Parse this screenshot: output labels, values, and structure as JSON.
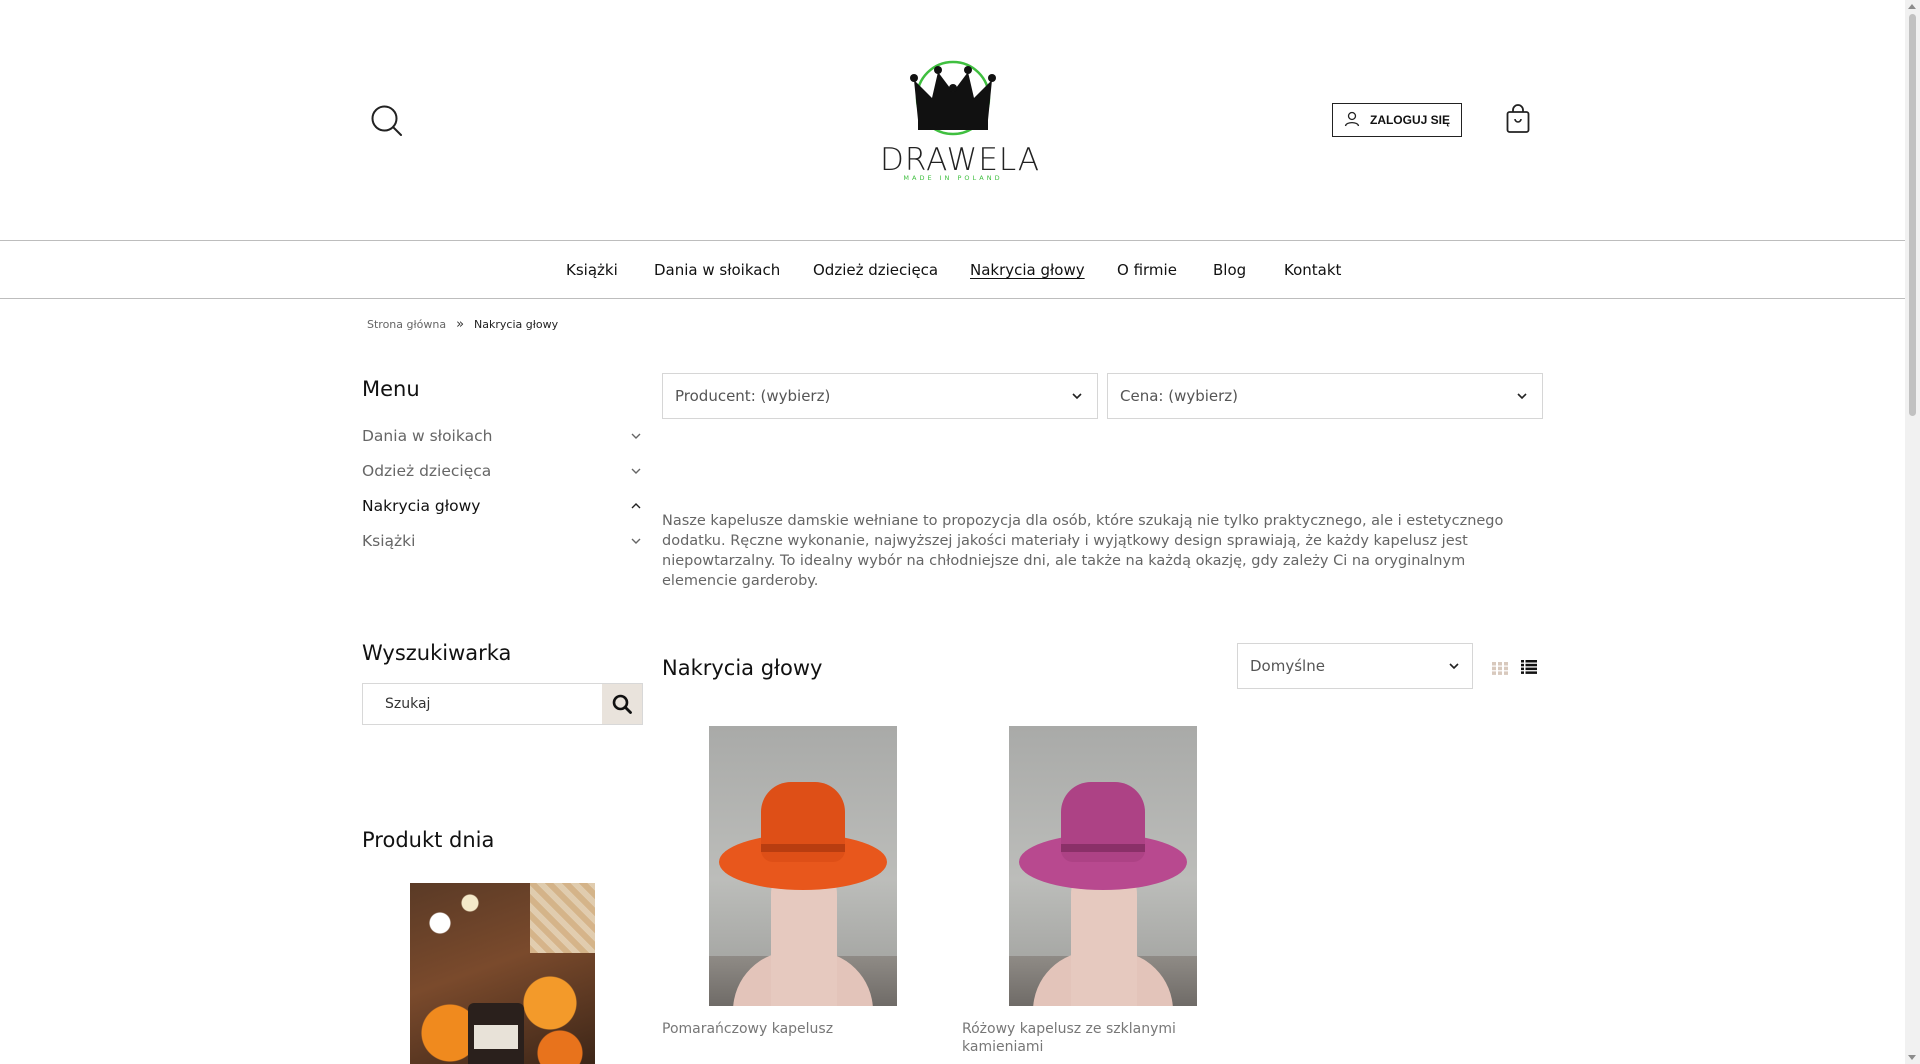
{
  "header": {
    "logo_text": "DRAWELA",
    "logo_sub": "MADE IN POLAND",
    "login_label": "ZALOGUJ SIĘ",
    "brand_color": "#3fbf3f"
  },
  "nav": {
    "items": [
      {
        "label": "Książki"
      },
      {
        "label": "Dania w słoikach"
      },
      {
        "label": "Odzież dziecięca"
      },
      {
        "label": "Nakrycia głowy",
        "active": true
      },
      {
        "label": "O firmie"
      },
      {
        "label": "Blog"
      },
      {
        "label": "Kontakt"
      }
    ]
  },
  "breadcrumb": {
    "home": "Strona główna",
    "separator": "»",
    "current": "Nakrycia głowy"
  },
  "sidebar": {
    "menu_title": "Menu",
    "items": [
      {
        "label": "Dania w słoikach",
        "expanded": false
      },
      {
        "label": "Odzież dziecięca",
        "expanded": false
      },
      {
        "label": "Nakrycia głowy",
        "expanded": true
      },
      {
        "label": "Książki",
        "expanded": false
      }
    ],
    "search_title": "Wyszukiwarka",
    "search_placeholder": "Szukaj",
    "product_day_title": "Produkt dnia"
  },
  "filters": {
    "producer": "Producent: (wybierz)",
    "price": "Cena: (wybierz)"
  },
  "description": "Nasze kapelusze damskie wełniane to propozycja dla osób, które szukają nie tylko praktycznego, ale i estetycznego dodatku. Ręczne wykonanie, najwyższej jakości materiały i wyjątkowy design sprawiają, że każdy kapelusz jest niepowtarzalny. To idealny wybór na chłodniejsze dni, ale także na każdą okazję, gdy zależy Ci na oryginalnym elemencie garderoby.",
  "listing": {
    "title": "Nakrycia głowy",
    "sort": "Domyślne",
    "products": [
      {
        "name": "Pomarańczowy kapelusz",
        "color": "#e8571c"
      },
      {
        "name": "Różowy kapelusz ze szklanymi kamieniami",
        "color": "#b8498f"
      }
    ]
  }
}
